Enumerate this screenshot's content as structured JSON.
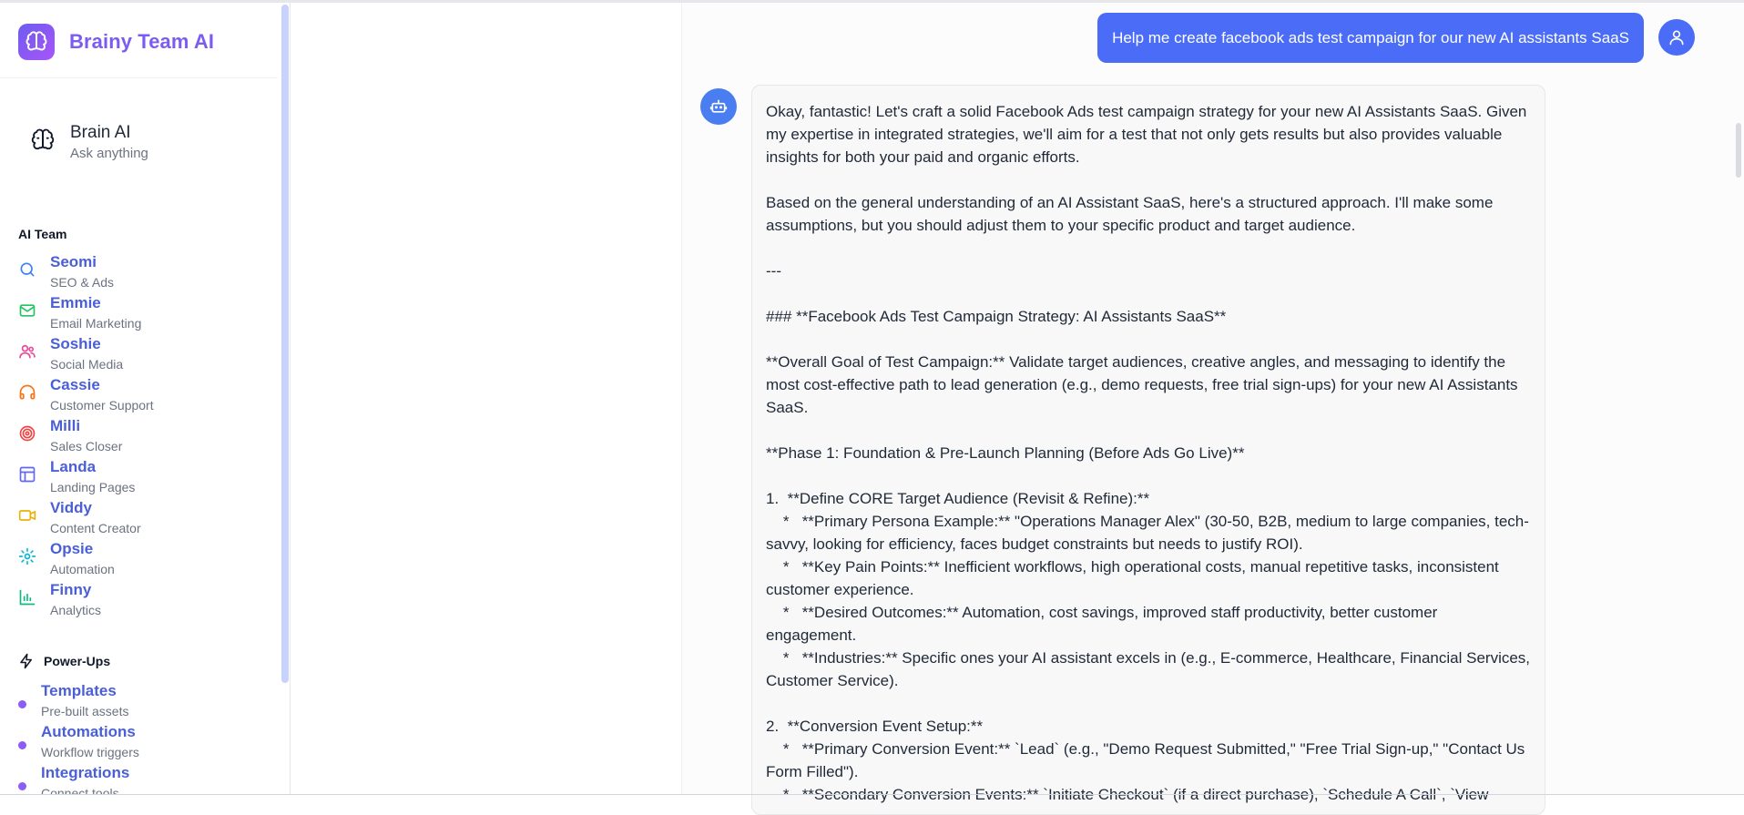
{
  "brand": {
    "name": "Brainy Team AI",
    "logo_icon": "brain-icon"
  },
  "brain": {
    "title": "Brain AI",
    "subtitle": "Ask anything",
    "icon": "brain-outline-icon"
  },
  "team_section": {
    "label": "AI Team"
  },
  "team": [
    {
      "name": "Seomi",
      "role": "SEO & Ads",
      "icon": "search-icon",
      "color": "#3b82f6"
    },
    {
      "name": "Emmie",
      "role": "Email Marketing",
      "icon": "mail-icon",
      "color": "#22c55e"
    },
    {
      "name": "Soshie",
      "role": "Social Media",
      "icon": "users-icon",
      "color": "#ec4899"
    },
    {
      "name": "Cassie",
      "role": "Customer Support",
      "icon": "headphones-icon",
      "color": "#f97316"
    },
    {
      "name": "Milli",
      "role": "Sales Closer",
      "icon": "target-icon",
      "color": "#ef4444"
    },
    {
      "name": "Landa",
      "role": "Landing Pages",
      "icon": "layout-icon",
      "color": "#6366f1"
    },
    {
      "name": "Viddy",
      "role": "Content Creator",
      "icon": "video-icon",
      "color": "#eab308"
    },
    {
      "name": "Opsie",
      "role": "Automation",
      "icon": "gear-icon",
      "color": "#06b6d4"
    },
    {
      "name": "Finny",
      "role": "Analytics",
      "icon": "bar-chart-icon",
      "color": "#10b981"
    }
  ],
  "powerups_section": {
    "label": "Power-Ups",
    "icon": "lightning-icon"
  },
  "powerups": [
    {
      "name": "Templates",
      "sub": "Pre-built assets"
    },
    {
      "name": "Automations",
      "sub": "Workflow triggers"
    },
    {
      "name": "Integrations",
      "sub": "Connect tools"
    }
  ],
  "chat": {
    "user_message": "Help me create facebook ads test campaign for our new AI assistants SaaS",
    "bot_message": "Okay, fantastic! Let's craft a solid Facebook Ads test campaign strategy for your new AI Assistants SaaS. Given my expertise in integrated strategies, we'll aim for a test that not only gets results but also provides valuable insights for both your paid and organic efforts.\n\nBased on the general understanding of an AI Assistant SaaS, here's a structured approach. I'll make some assumptions, but you should adjust them to your specific product and target audience.\n\n---\n\n### **Facebook Ads Test Campaign Strategy: AI Assistants SaaS**\n\n**Overall Goal of Test Campaign:** Validate target audiences, creative angles, and messaging to identify the most cost-effective path to lead generation (e.g., demo requests, free trial sign-ups) for your new AI Assistants SaaS.\n\n**Phase 1: Foundation & Pre-Launch Planning (Before Ads Go Live)**\n\n1.  **Define CORE Target Audience (Revisit & Refine):**\n    *   **Primary Persona Example:** \"Operations Manager Alex\" (30-50, B2B, medium to large companies, tech-savvy, looking for efficiency, faces budget constraints but needs to justify ROI).\n    *   **Key Pain Points:** Inefficient workflows, high operational costs, manual repetitive tasks, inconsistent customer experience.\n    *   **Desired Outcomes:** Automation, cost savings, improved staff productivity, better customer engagement.\n    *   **Industries:** Specific ones your AI assistant excels in (e.g., E-commerce, Healthcare, Financial Services, Customer Service).\n\n2.  **Conversion Event Setup:**\n    *   **Primary Conversion Event:** `Lead` (e.g., \"Demo Request Submitted,\" \"Free Trial Sign-up,\" \"Contact Us Form Filled\").\n    *   **Secondary Conversion Events:** `Initiate Checkout` (if a direct purchase), `Schedule A Call`, `View"
  }
}
